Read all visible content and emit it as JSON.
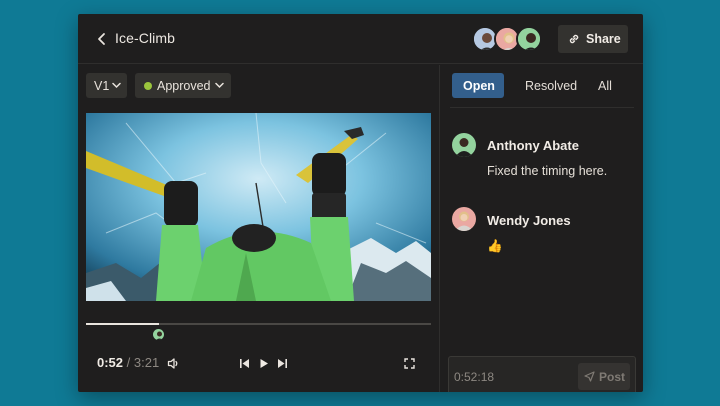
{
  "header": {
    "title": "Ice-Climb",
    "share_label": "Share",
    "collaborators": [
      {
        "name": "collaborator-1",
        "color": "#9fb7d6"
      },
      {
        "name": "collaborator-2",
        "color": "#e8a3a0"
      },
      {
        "name": "collaborator-3",
        "color": "#8fcf9a"
      }
    ]
  },
  "toolbar": {
    "version_label": "V1",
    "status_label": "Approved",
    "status_color": "#9bc53d"
  },
  "player": {
    "current_time": "0:52",
    "separator": "/",
    "duration": "3:21",
    "progress": 0.26
  },
  "comments_panel": {
    "tabs": [
      {
        "label": "Open",
        "active": true
      },
      {
        "label": "Resolved",
        "active": false
      },
      {
        "label": "All",
        "active": false
      }
    ],
    "comments": [
      {
        "author": "Anthony Abate",
        "text": "Fixed the timing here."
      },
      {
        "author": "Wendy Jones",
        "text": "👍"
      }
    ],
    "composer": {
      "timestamp": "0:52:18",
      "post_label": "Post"
    }
  },
  "colors": {
    "background": "#0f7a95",
    "window": "#1f1e1e",
    "accent_tab": "#335f8c"
  }
}
